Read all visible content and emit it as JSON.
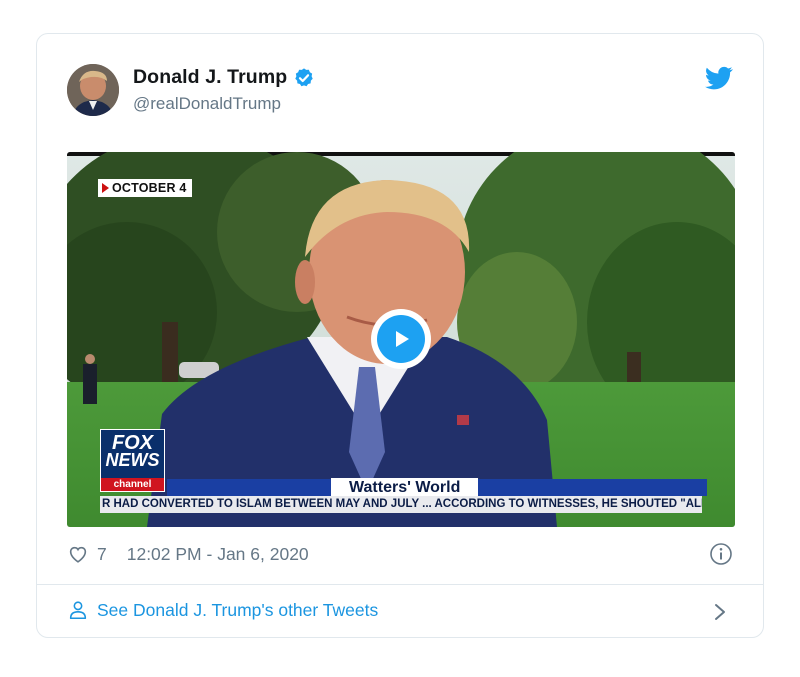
{
  "tweet": {
    "author_name": "Donald J. Trump",
    "author_handle": "@realDonaldTrump",
    "likes": "7",
    "timestamp": "12:02 PM - Jan 6, 2020",
    "footer_link": "See Donald J. Trump's other Tweets"
  },
  "video": {
    "date_tag": "OCTOBER 4",
    "network_line1": "FOX",
    "network_line2": "NEWS",
    "network_line3": "channel",
    "show_title": "Watters' World",
    "ticker": "R HAD CONVERTED TO ISLAM BETWEEN MAY AND JULY ...  ACCORDING TO WITNESSES, HE SHOUTED \"ALL"
  },
  "icons": {
    "verified": "verified-badge-icon",
    "twitter": "twitter-bird-icon",
    "play": "play-icon",
    "like": "heart-icon",
    "info": "info-icon",
    "user": "user-icon",
    "chevron": "chevron-right-icon"
  },
  "colors": {
    "accent": "#1da1f2",
    "link": "#1b95e0",
    "muted": "#657786",
    "border": "#e1e8ed"
  }
}
